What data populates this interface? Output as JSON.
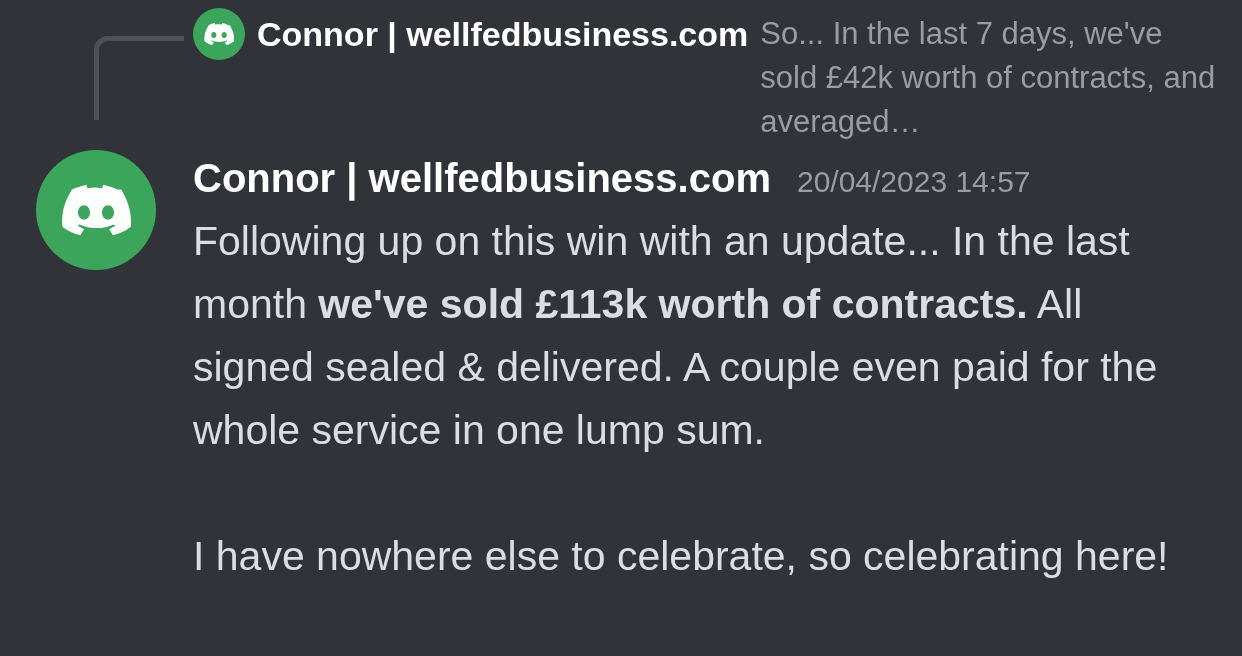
{
  "reply": {
    "author": "Connor | wellfedbusiness.com",
    "preview": "So... In the last 7 days, we've sold £42k worth of contracts, and averaged…"
  },
  "message": {
    "author": "Connor | wellfedbusiness.com",
    "timestamp": "20/04/2023 14:57",
    "paragraphs": [
      "Following up on this win with an update... In the last month **we've sold £113k worth of contracts.** All signed sealed & delivered. A couple even paid for the whole service in one lump sum.",
      "I have nowhere else to celebrate, so celebrating here!"
    ]
  }
}
